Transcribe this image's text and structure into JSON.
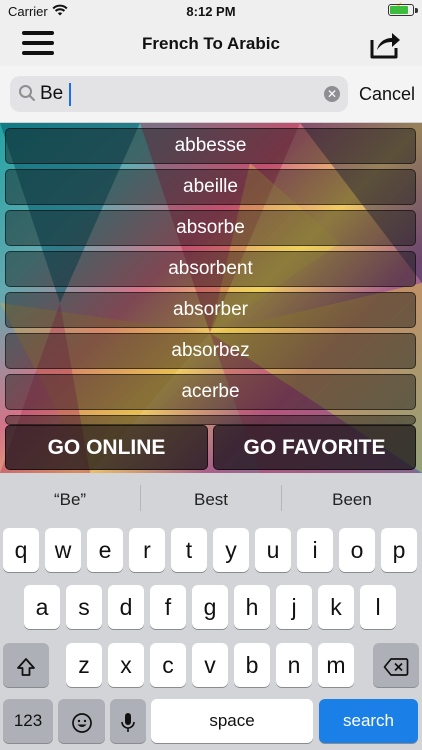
{
  "status": {
    "carrier": "Carrier",
    "time": "8:12 PM"
  },
  "nav": {
    "title": "French To Arabic"
  },
  "search": {
    "value": "Be",
    "cancel": "Cancel"
  },
  "results": [
    "abbesse",
    "abeille",
    "absorbe",
    "absorbent",
    "absorber",
    "absorbez",
    "acerbe"
  ],
  "actions": {
    "online": "GO ONLINE",
    "favorite": "GO FAVORITE"
  },
  "suggestions": [
    "“Be”",
    "Best",
    "Been"
  ],
  "keyboard": {
    "row1": [
      "q",
      "w",
      "e",
      "r",
      "t",
      "y",
      "u",
      "i",
      "o",
      "p"
    ],
    "row2": [
      "a",
      "s",
      "d",
      "f",
      "g",
      "h",
      "j",
      "k",
      "l"
    ],
    "row3": [
      "z",
      "x",
      "c",
      "v",
      "b",
      "n",
      "m"
    ],
    "numbers": "123",
    "space": "space",
    "search": "search"
  }
}
